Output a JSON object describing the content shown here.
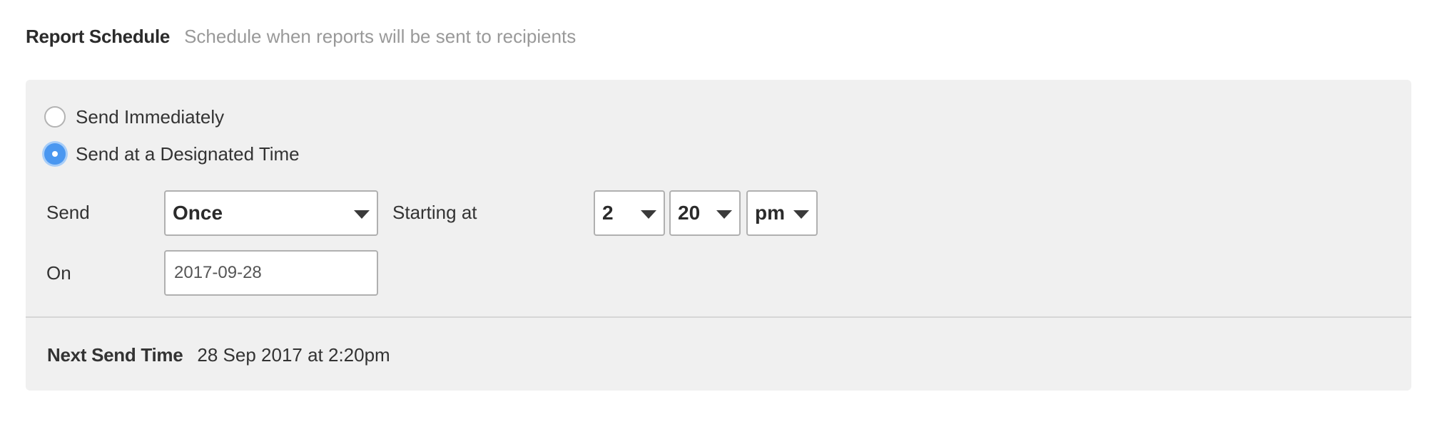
{
  "header": {
    "title": "Report Schedule",
    "subtitle": "Schedule when reports will be sent to recipients"
  },
  "options": {
    "send_immediately": {
      "label": "Send Immediately",
      "checked": false
    },
    "send_designated": {
      "label": "Send at a Designated Time",
      "checked": true
    }
  },
  "schedule": {
    "send_label": "Send",
    "frequency": "Once",
    "starting_at_label": "Starting at",
    "hour": "2",
    "minute": "20",
    "ampm": "pm",
    "on_label": "On",
    "date": "2017-09-28"
  },
  "next_send": {
    "label": "Next Send Time",
    "value": "28 Sep 2017 at 2:20pm"
  },
  "colors": {
    "accent": "#4a97f0",
    "panel_bg": "#f0f0f0",
    "subtitle_text": "#999999"
  },
  "icons": {
    "dropdown": "caret-down-icon"
  }
}
